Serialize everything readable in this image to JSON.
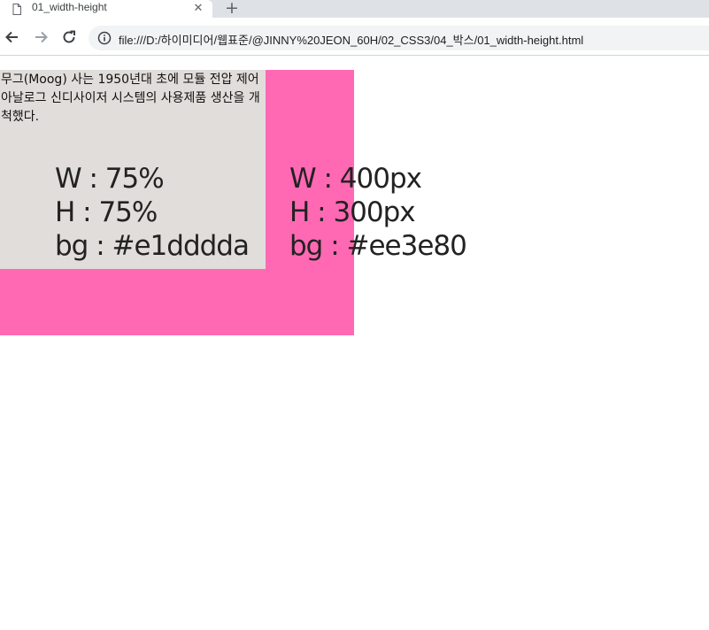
{
  "browser": {
    "tab_title": "01_width-height",
    "tab_close": "✕",
    "new_tab": "+",
    "url": "file:///D:/하이미디어/웹표준/@JINNY%20JEON_60H/02_CSS3/04_박스/01_width-height.html"
  },
  "page": {
    "paragraph": "무그(Moog) 사는 1950년대 초에 모듈 전압 제어 아날로그 신디사이저 시스템의 사용제품 생산을 개척했다.",
    "inner_spec": {
      "width": "W : 75%",
      "height": "H : 75%",
      "bg": "bg : #e1dddda"
    },
    "outer_spec": {
      "width": "W : 400px",
      "height": "H : 300px",
      "bg": "bg : #ee3e80"
    }
  },
  "colors": {
    "outer_bg": "#ff69b4",
    "inner_bg": "#e1ddda"
  },
  "icons": [
    "page-icon",
    "close-icon",
    "plus-icon",
    "back-arrow-icon",
    "forward-arrow-icon",
    "reload-icon",
    "info-icon"
  ]
}
